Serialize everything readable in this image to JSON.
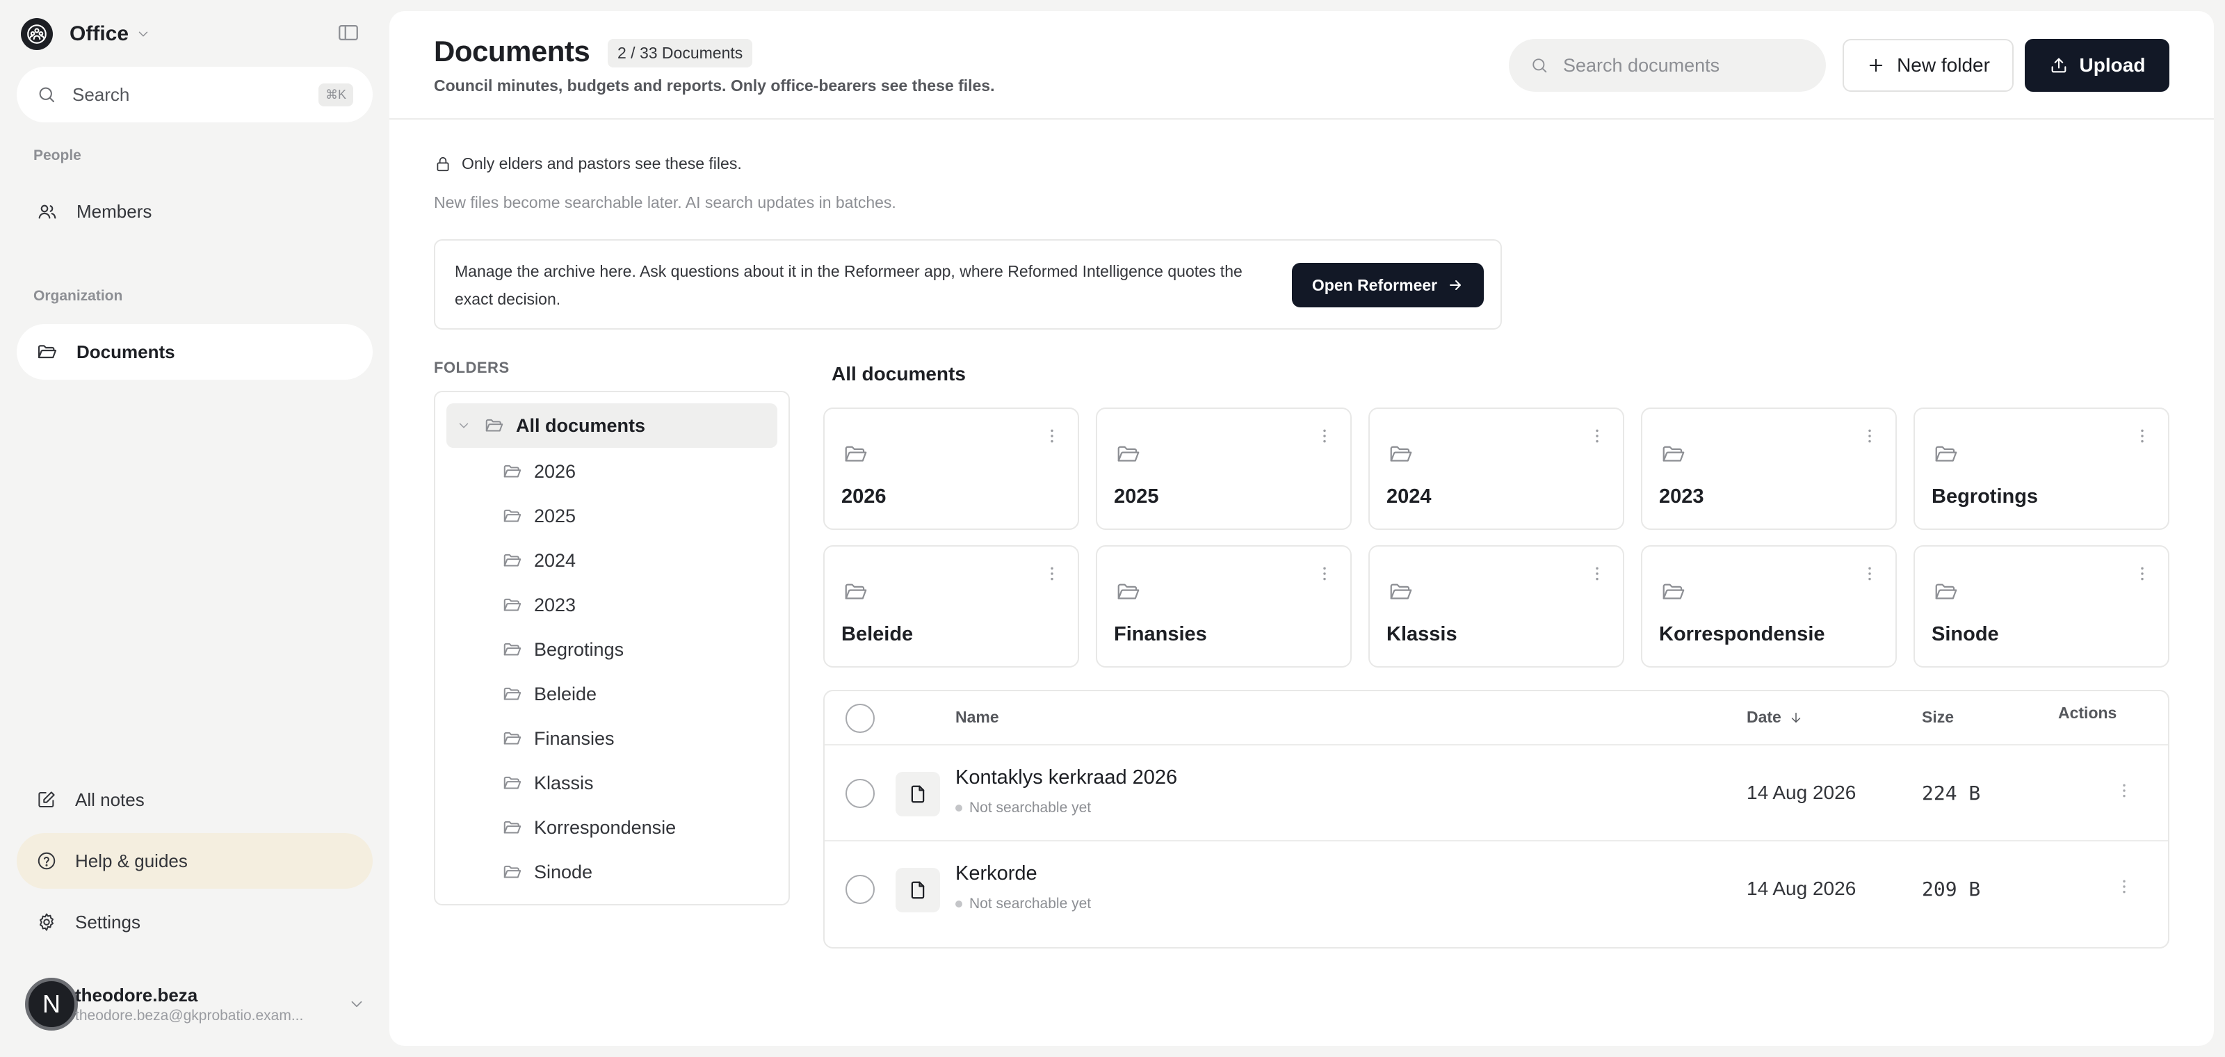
{
  "sidebar": {
    "workspace_name": "Office",
    "search_label": "Search",
    "search_shortcut": "⌘K",
    "people_label": "People",
    "members_label": "Members",
    "organization_label": "Organization",
    "documents_label": "Documents",
    "all_notes_label": "All notes",
    "help_label": "Help & guides",
    "settings_label": "Settings",
    "user": {
      "initial": "N",
      "name": "theodore.beza",
      "email": "theodore.beza@gkprobatio.exam..."
    }
  },
  "header": {
    "title": "Documents",
    "count": "2 / 33 Documents",
    "subtitle": "Council minutes, budgets and reports. Only office-bearers see these files.",
    "search_placeholder": "Search documents",
    "new_folder_label": "New folder",
    "upload_label": "Upload"
  },
  "notice": "Only elders and pastors see these files.",
  "hint": "New files become searchable later. AI search updates in batches.",
  "banner": {
    "text": "Manage the archive here. Ask questions about it in the Reformeer app, where Reformed Intelligence quotes the exact decision.",
    "button_label": "Open Reformeer"
  },
  "folders": {
    "section_label": "FOLDERS",
    "root_label": "All documents",
    "items": [
      "2026",
      "2025",
      "2024",
      "2023",
      "Begrotings",
      "Beleide",
      "Finansies",
      "Klassis",
      "Korrespondensie",
      "Sinode"
    ]
  },
  "content": {
    "title": "All documents",
    "cards": [
      "2026",
      "2025",
      "2024",
      "2023",
      "Begrotings",
      "Beleide",
      "Finansies",
      "Klassis",
      "Korrespondensie",
      "Sinode"
    ]
  },
  "table": {
    "headers": {
      "name": "Name",
      "date": "Date",
      "size": "Size",
      "actions": "Actions"
    },
    "rows": [
      {
        "name": "Kontaklys kerkraad 2026",
        "status": "Not searchable yet",
        "date": "14 Aug 2026",
        "size": "224 B"
      },
      {
        "name": "Kerkorde",
        "status": "Not searchable yet",
        "date": "14 Aug 2026",
        "size": "209 B"
      }
    ]
  }
}
